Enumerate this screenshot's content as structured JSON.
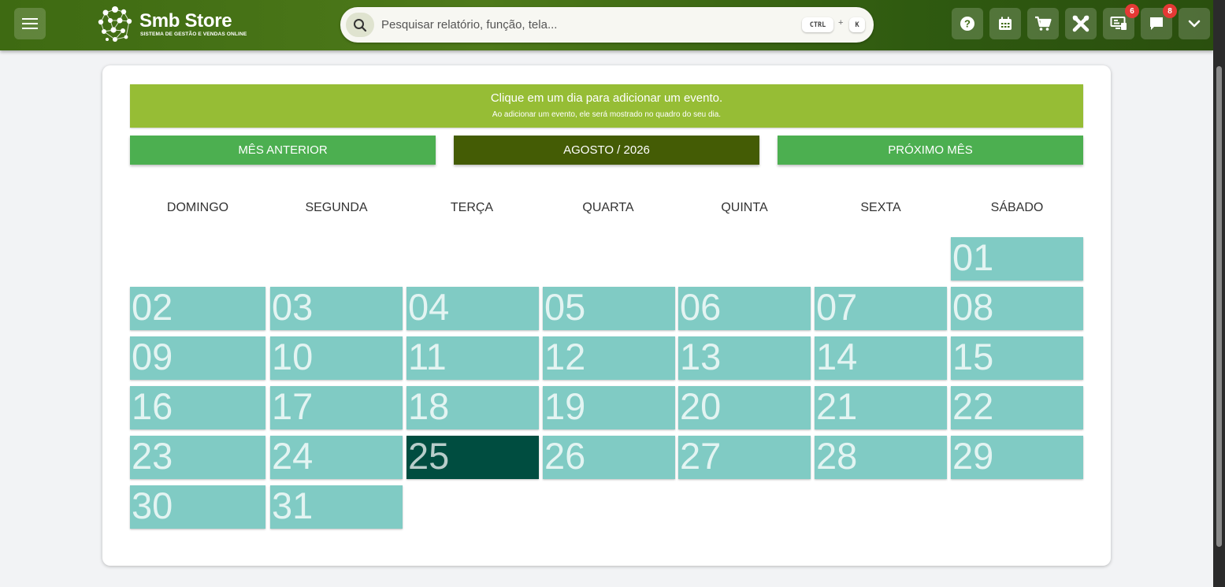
{
  "header": {
    "brand_name": "Smb Store",
    "brand_tagline": "SISTEMA DE GESTÃO E VENDAS ONLINE",
    "search": {
      "placeholder": "Pesquisar relatório, função, tela...",
      "value": "",
      "shortcut_key1": "CTRL",
      "shortcut_plus": "+",
      "shortcut_key2": "K"
    },
    "buttons": [
      {
        "icon": "help-icon"
      },
      {
        "icon": "calendar-icon"
      },
      {
        "icon": "cart-icon"
      },
      {
        "icon": "tools-icon"
      },
      {
        "icon": "monitor-icon",
        "badge": "6"
      },
      {
        "icon": "chat-icon",
        "badge": "8"
      },
      {
        "icon": "chevron-down-icon"
      }
    ]
  },
  "banner": {
    "title": "Clique em um dia para adicionar um evento.",
    "subtitle": "Ao adicionar um evento, ele será mostrado no quadro do seu dia."
  },
  "nav": {
    "prev_label": "MÊS ANTERIOR",
    "current_label": "AGOSTO / 2026",
    "next_label": "PRÓXIMO MÊS"
  },
  "weekdays": [
    "DOMINGO",
    "SEGUNDA",
    "TERÇA",
    "QUARTA",
    "QUINTA",
    "SEXTA",
    "SÁBADO"
  ],
  "calendar": {
    "first_weekday": 6,
    "days": [
      "01",
      "02",
      "03",
      "04",
      "05",
      "06",
      "07",
      "08",
      "09",
      "10",
      "11",
      "12",
      "13",
      "14",
      "15",
      "16",
      "17",
      "18",
      "19",
      "20",
      "21",
      "22",
      "23",
      "24",
      "25",
      "26",
      "27",
      "28",
      "29",
      "30",
      "31"
    ],
    "selected_day": "25"
  },
  "colors": {
    "day_cell": "#80cbc4",
    "today_cell": "#004d40",
    "banner": "#96bd35",
    "nav_button": "#4caf50",
    "current_month": "#445c05"
  }
}
